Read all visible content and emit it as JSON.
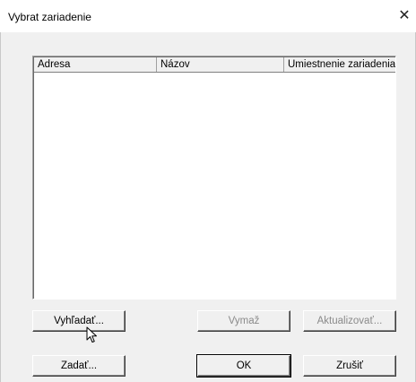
{
  "window": {
    "title": "Vybrat zariadenie",
    "close_glyph": "✕"
  },
  "list": {
    "columns": [
      "Adresa",
      "Názov",
      "Umiestnenie zariadenia"
    ],
    "rows": []
  },
  "buttons": {
    "search": "Vyhľadať...",
    "delete": "Vymaž",
    "refresh": "Aktualizovať...",
    "enter": "Zadať...",
    "ok": "OK",
    "cancel": "Zrušiť"
  },
  "icons": {
    "close": "close-icon",
    "cursor": "mouse-pointer-icon"
  }
}
